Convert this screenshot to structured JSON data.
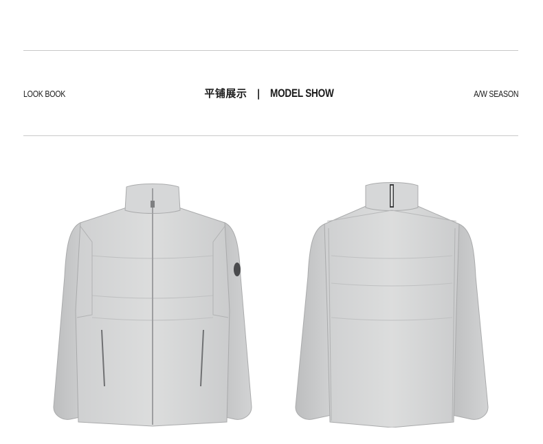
{
  "header": {
    "left_label": "LOOK BOOK",
    "title_cn": "平铺展示",
    "separator": "|",
    "title_en": "MODEL SHOW",
    "right_label": "A/W SEASON"
  },
  "products": [
    {
      "view": "front",
      "color": "#c9cacb"
    },
    {
      "view": "back",
      "color": "#c9cacb"
    }
  ]
}
